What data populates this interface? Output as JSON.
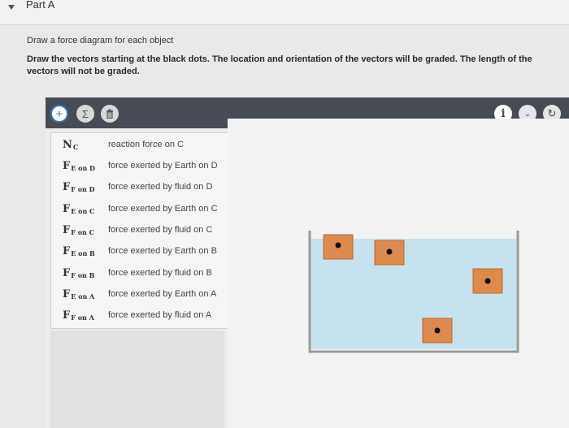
{
  "part": {
    "title": "Part A"
  },
  "instructions": {
    "line1": "Draw a force diagram for each object",
    "line2": "Draw the vectors starting at the black dots. The location and orientation of the vectors will be graded. The length of the vectors will not be graded."
  },
  "toolbar": {
    "add_icon": "plus-icon",
    "sigma_icon": "sigma-icon",
    "trash_icon": "trash-icon",
    "info_icon": "info-icon",
    "chevron_icon": "chevron-down-icon",
    "reset_icon": "reset-icon",
    "plus_glyph": "+",
    "sigma_glyph": "Σ",
    "info_glyph": "i",
    "chevron_glyph": "⌄",
    "reset_glyph": "↻"
  },
  "vectors": [
    {
      "symbol": "N",
      "sub": "C",
      "desc": "reaction force on C"
    },
    {
      "symbol": "F",
      "sub": "E on D",
      "desc": "force exerted by Earth on D"
    },
    {
      "symbol": "F",
      "sub": "F on D",
      "desc": "force exerted by fluid on D"
    },
    {
      "symbol": "F",
      "sub": "E on C",
      "desc": "force exerted by Earth on C"
    },
    {
      "symbol": "F",
      "sub": "F on C",
      "desc": "force exerted by fluid on C"
    },
    {
      "symbol": "F",
      "sub": "E on B",
      "desc": "force exerted by Earth on B"
    },
    {
      "symbol": "F",
      "sub": "F on B",
      "desc": "force exerted by fluid on B"
    },
    {
      "symbol": "F",
      "sub": "E on A",
      "desc": "force exerted by Earth on A"
    },
    {
      "symbol": "F",
      "sub": "F on A",
      "desc": "force exerted by fluid on A"
    }
  ],
  "colors": {
    "toolbar": "#474b55",
    "water": "#c6e2ee",
    "block": "#dc8a4e",
    "accent": "#3c79b5"
  }
}
